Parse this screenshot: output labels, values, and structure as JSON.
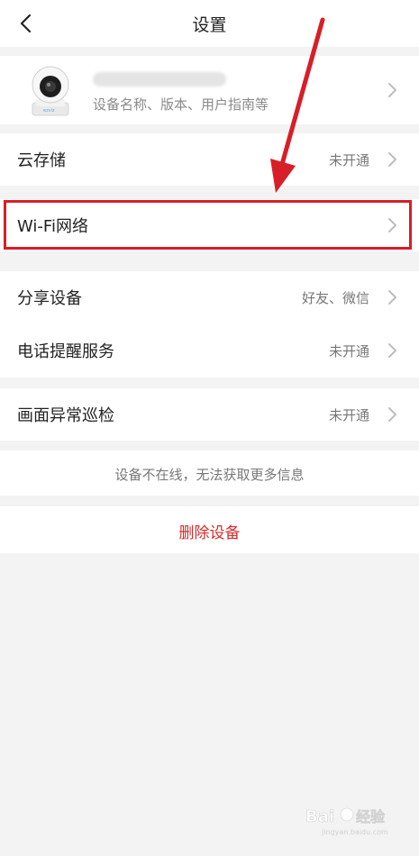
{
  "nav": {
    "title": "设置"
  },
  "device": {
    "subtitle": "设备名称、版本、用户指南等"
  },
  "cloud": {
    "label": "云存储",
    "value": "未开通"
  },
  "wifi": {
    "label": "Wi-Fi网络"
  },
  "share": {
    "label": "分享设备",
    "value": "好友、微信"
  },
  "phone_alert": {
    "label": "电话提醒服务",
    "value": "未开通"
  },
  "patrol": {
    "label": "画面异常巡检",
    "value": "未开通"
  },
  "offline_notice": "设备不在线，无法获取更多信息",
  "delete_label": "删除设备",
  "colors": {
    "accent_red": "#d62b2b",
    "highlight_red": "#d81e27",
    "background": "#f3f3f3"
  }
}
